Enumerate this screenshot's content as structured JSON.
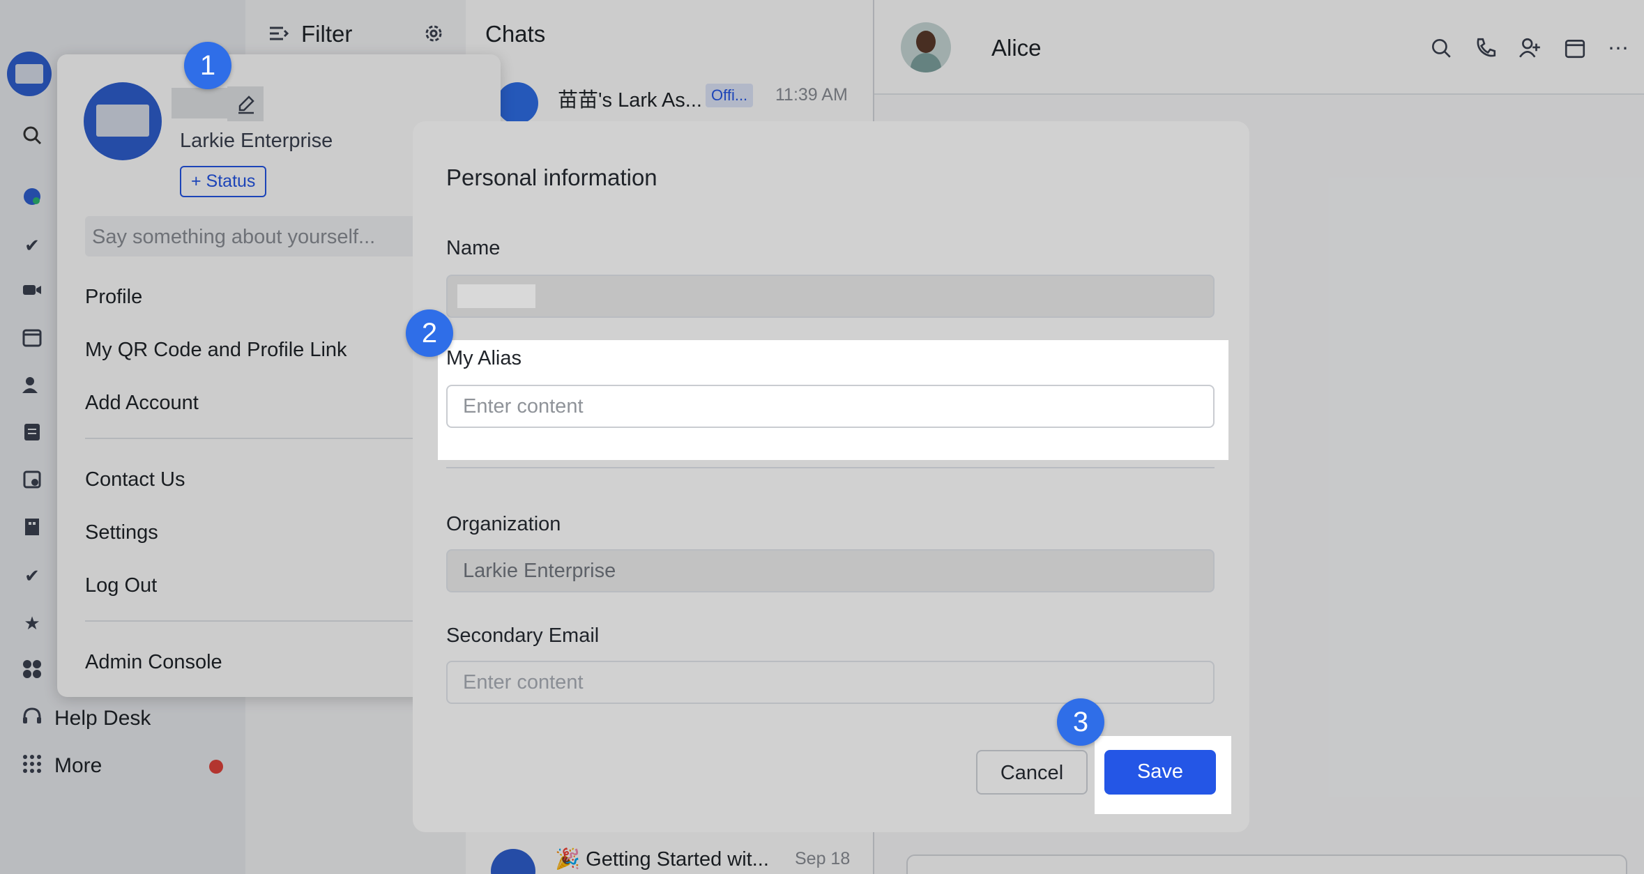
{
  "filter": {
    "title": "Filter"
  },
  "chats": {
    "title": "Chats",
    "items": [
      {
        "name": "苗苗's Lark As...",
        "tag": "Offi...",
        "time": "11:39 AM"
      },
      {
        "name": "🎉 Getting Started wit...",
        "time": "Sep 18"
      }
    ]
  },
  "chat_pane": {
    "contact_name": "Alice"
  },
  "rail": {
    "items": [
      {
        "label": "Help Desk"
      },
      {
        "label": "More"
      }
    ]
  },
  "profile_popover": {
    "org": "Larkie Enterprise",
    "status_button": "+ Status",
    "about_placeholder": "Say something about yourself...",
    "menu": [
      "Profile",
      "My QR Code and Profile Link",
      "Add Account",
      "Contact Us",
      "Settings",
      "Log Out",
      "Admin Console"
    ]
  },
  "modal": {
    "title": "Personal information",
    "name_label": "Name",
    "alias_label": "My Alias",
    "alias_placeholder": "Enter content",
    "org_label": "Organization",
    "org_value": "Larkie Enterprise",
    "email_label": "Secondary Email",
    "email_placeholder": "Enter content",
    "cancel": "Cancel",
    "save": "Save"
  },
  "badges": [
    "1",
    "2",
    "3"
  ],
  "colors": {
    "accent": "#2456e6",
    "badge": "#2f6ee8",
    "notification": "#e0433b"
  }
}
